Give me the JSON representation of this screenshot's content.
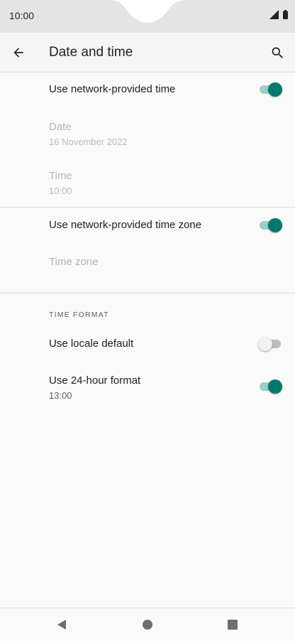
{
  "status_bar": {
    "time": "10:00",
    "icons": [
      "signal-icon",
      "battery-icon"
    ]
  },
  "app_bar": {
    "title": "Date and time",
    "icons": [
      "back-arrow-icon",
      "search-icon"
    ]
  },
  "settings": {
    "network_time": {
      "title": "Use network-provided time",
      "enabled": true
    },
    "date": {
      "title": "Date",
      "summary": "16 November 2022",
      "disabled": true
    },
    "time": {
      "title": "Time",
      "summary": "10:00",
      "disabled": true
    },
    "network_time_zone": {
      "title": "Use network-provided time zone",
      "enabled": true
    },
    "time_zone": {
      "title": "Time zone",
      "disabled": true
    },
    "time_format": {
      "header": "TIME FORMAT",
      "locale_default": {
        "title": "Use locale default",
        "enabled": false
      },
      "use_24_hour": {
        "title": "Use 24-hour format",
        "summary": "13:00",
        "enabled": true
      }
    }
  },
  "colors": {
    "accent": "#00796b",
    "accent_track": "#9ccfc8"
  },
  "nav_bar": {
    "icons": [
      "back-triangle-icon",
      "home-circle-icon",
      "recents-square-icon"
    ]
  }
}
